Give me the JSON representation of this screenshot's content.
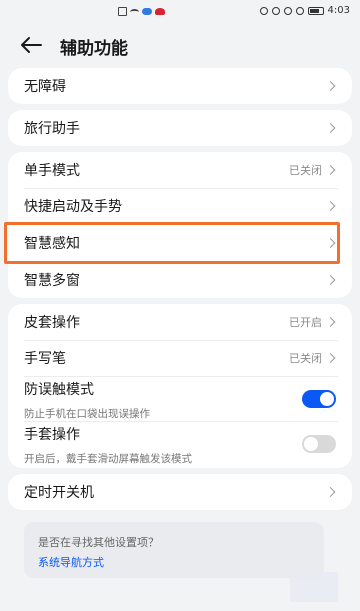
{
  "status_bar": {
    "time": "4:03",
    "icons": [
      "doc-icon",
      "wifi-icon",
      "cloud-icon",
      "huawei-icon",
      "eye-icon",
      "headphone-icon",
      "vibrate-icon",
      "signal-icon",
      "battery-icon"
    ]
  },
  "header": {
    "title": "辅助功能",
    "back_icon": "back-arrow-icon"
  },
  "groups": [
    {
      "items": [
        {
          "label": "无障碍"
        }
      ]
    },
    {
      "items": [
        {
          "label": "旅行助手"
        }
      ]
    },
    {
      "items": [
        {
          "label": "单手模式",
          "status": "已关闭"
        },
        {
          "label": "快捷启动及手势"
        },
        {
          "label": "智慧感知"
        },
        {
          "label": "智慧多窗"
        }
      ]
    },
    {
      "items": [
        {
          "label": "皮套操作",
          "status": "已开启"
        },
        {
          "label": "手写笔",
          "status": "已关闭"
        },
        {
          "label": "防误触模式",
          "sub": "防止手机在口袋出现误操作",
          "toggle": true
        },
        {
          "label": "手套操作",
          "sub": "开启后，戴手套滑动屏幕触发该模式",
          "toggle": false
        }
      ]
    },
    {
      "items": [
        {
          "label": "定时开关机"
        }
      ]
    }
  ],
  "suggestion": {
    "question": "是否在寻找其他设置项？",
    "link": "系统导航方式"
  },
  "colors": {
    "accent": "#0a59f7",
    "highlight": "#f2702e",
    "background": "#f1f3f5"
  }
}
